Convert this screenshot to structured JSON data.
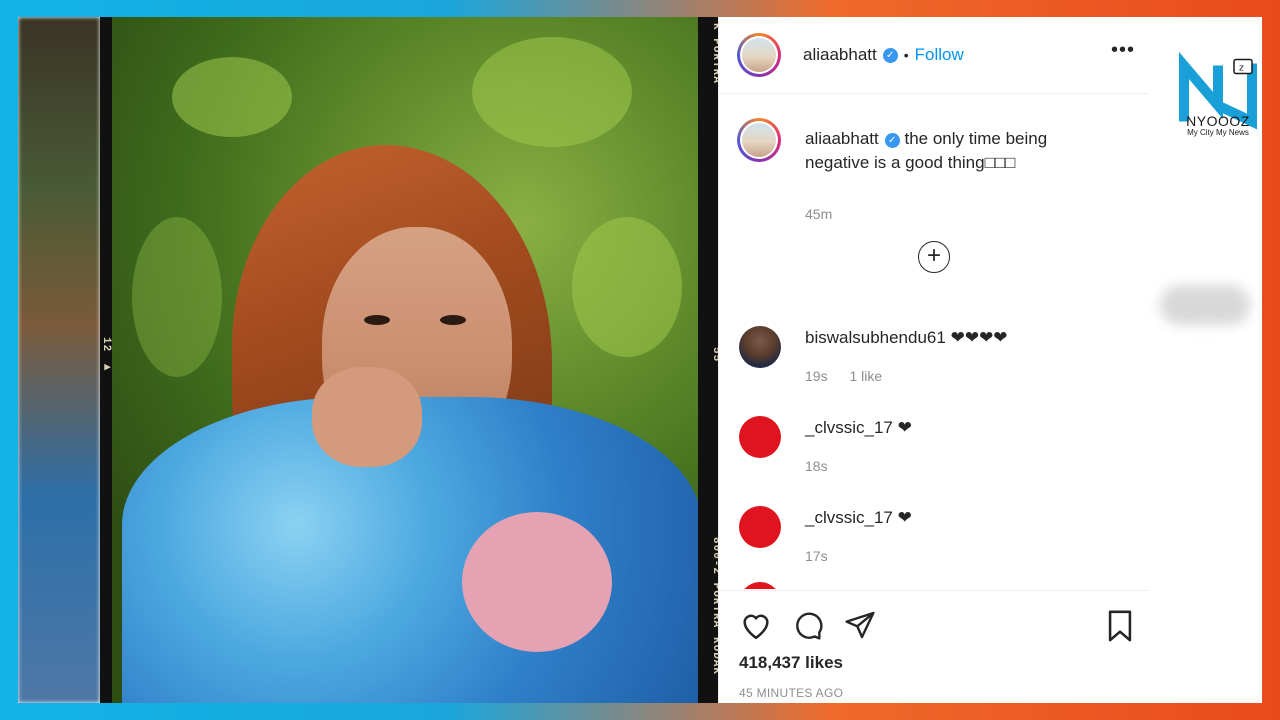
{
  "post": {
    "username": "aliaabhatt",
    "follow_label": "Follow",
    "more_label": "•••",
    "likes": "418,437 likes",
    "time_ago": "45 MINUTES AGO"
  },
  "film_marks": {
    "top": "K PORTRA",
    "mid_left": "12 ▶",
    "mid_right": "55",
    "bottom": "800-2 PORTRA",
    "bottom2": "KODAK"
  },
  "comments": [
    {
      "user": "aliaabhatt",
      "text": "the only time being negative is a good thing□□□",
      "time": "45m",
      "likes": ""
    },
    {
      "user": "biswalsubhendu61",
      "text": "❤❤❤❤",
      "time": "19s",
      "likes": "1 like"
    },
    {
      "user": "_clvssic_17",
      "text": "❤",
      "time": "18s",
      "likes": ""
    },
    {
      "user": "_clvssic_17",
      "text": "❤",
      "time": "17s",
      "likes": ""
    }
  ],
  "brand": {
    "name": "NYOOOZ",
    "tagline": "My City My News"
  },
  "colors": {
    "accent": "#0095f6",
    "verified": "#3897f0",
    "comment_avatar_red": "#e0141e"
  }
}
